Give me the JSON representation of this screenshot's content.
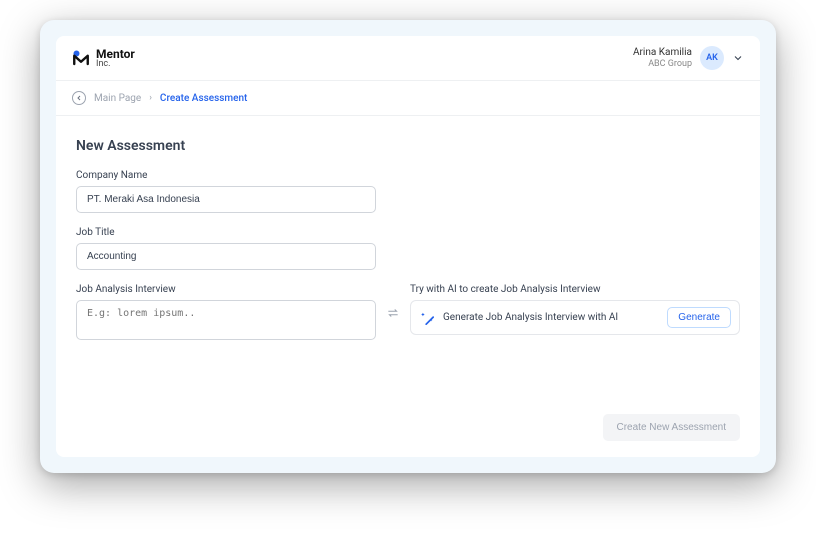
{
  "brand": {
    "name": "Mentor",
    "sub": "Inc."
  },
  "user": {
    "name": "Arina Kamilia",
    "org": "ABC Group",
    "initials": "AK"
  },
  "breadcrumb": {
    "main": "Main Page",
    "current": "Create Assessment"
  },
  "page": {
    "title": "New Assessment"
  },
  "form": {
    "company_label": "Company Name",
    "company_value": "PT. Meraki Asa Indonesia",
    "jobtitle_label": "Job Title",
    "jobtitle_value": "Accounting",
    "jai_label": "Job Analysis Interview",
    "jai_placeholder": "E.g: lorem ipsum..",
    "ai_hint": "Try with AI to create Job Analysis Interview",
    "ai_card_text": "Generate Job Analysis Interview with AI",
    "generate_label": "Generate",
    "submit_label": "Create New Assessment"
  }
}
